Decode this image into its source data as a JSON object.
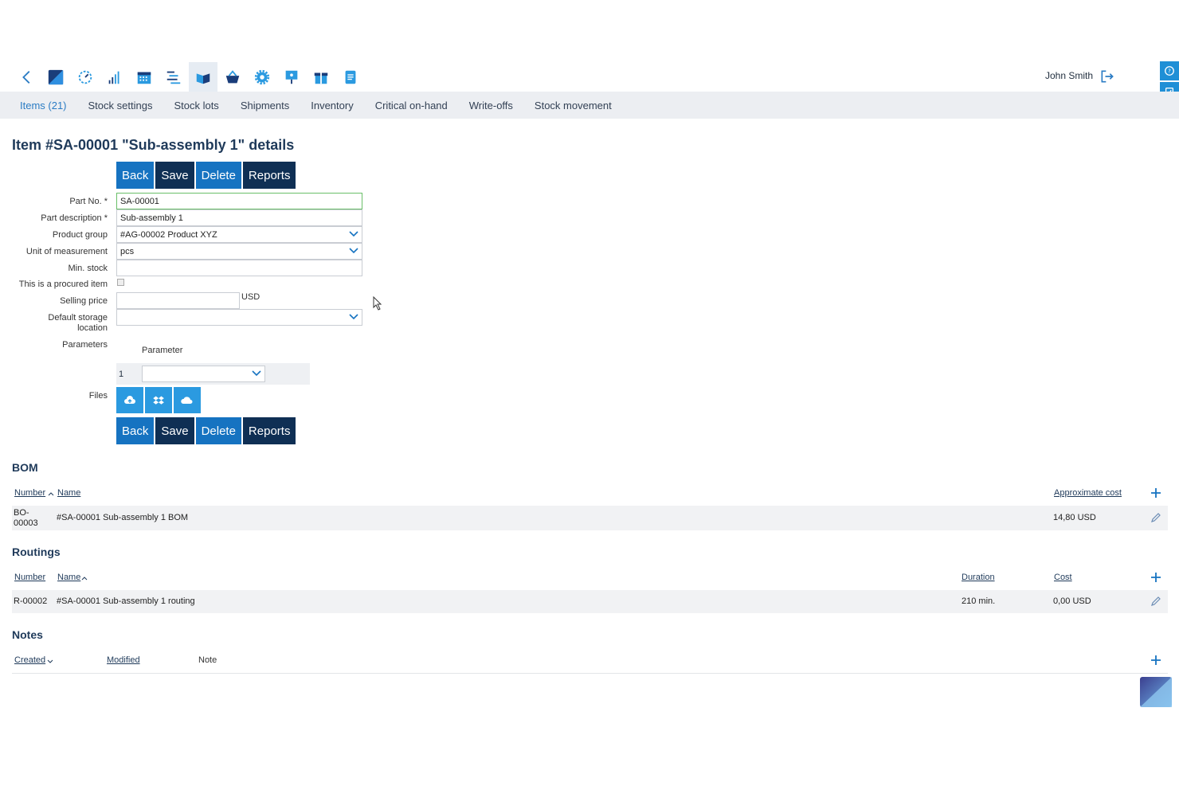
{
  "colors": {
    "accent": "#1673c1",
    "dark": "#0f2f54",
    "files": "#2b9ae0"
  },
  "topbar": {
    "icons": [
      "back-chevron-icon",
      "app-logo-icon",
      "dashboard-icon",
      "stats-icon",
      "calendar-icon",
      "tasks-icon",
      "stock-icon",
      "purchasing-icon",
      "settings-icon",
      "presentation-icon",
      "gift-icon",
      "document-icon"
    ],
    "user_name": "John Smith"
  },
  "subnav": {
    "items": [
      "Items (21)",
      "Stock settings",
      "Stock lots",
      "Shipments",
      "Inventory",
      "Critical on-hand",
      "Write-offs",
      "Stock movement"
    ]
  },
  "page": {
    "title": "Item #SA-00001 \"Sub-assembly 1\" details"
  },
  "buttons": {
    "back": "Back",
    "save": "Save",
    "delete": "Delete",
    "reports": "Reports"
  },
  "form": {
    "part_no_label": "Part No. *",
    "part_no": "SA-00001",
    "part_desc_label": "Part description *",
    "part_desc": "Sub-assembly 1",
    "product_group_label": "Product group",
    "product_group": "#AG-00002 Product XYZ",
    "uom_label": "Unit of measurement",
    "uom": "pcs",
    "min_stock_label": "Min. stock",
    "min_stock": "",
    "procured_label": "This is a procured item",
    "selling_price_label": "Selling price",
    "selling_price": "",
    "currency": "USD",
    "storage_label_1": "Default storage",
    "storage_label_2": "location",
    "storage": "",
    "parameters_label": "Parameters",
    "parameter_header": "Parameter",
    "parameter_row_num": "1",
    "files_label": "Files"
  },
  "bom": {
    "title": "BOM",
    "headers": {
      "number": "Number",
      "name": "Name",
      "cost": "Approximate cost"
    },
    "rows": [
      {
        "number_1": "BO-",
        "number_2": "00003",
        "name": "#SA-00001 Sub-assembly 1 BOM",
        "cost": "14,80 USD"
      }
    ]
  },
  "routings": {
    "title": "Routings",
    "headers": {
      "number": "Number",
      "name": "Name",
      "duration": "Duration",
      "cost": "Cost"
    },
    "rows": [
      {
        "number": "R-00002",
        "name": "#SA-00001 Sub-assembly 1 routing",
        "duration": "210 min.",
        "cost": "0,00 USD"
      }
    ]
  },
  "notes": {
    "title": "Notes",
    "headers": {
      "created": "Created",
      "modified": "Modified",
      "note": "Note"
    }
  }
}
